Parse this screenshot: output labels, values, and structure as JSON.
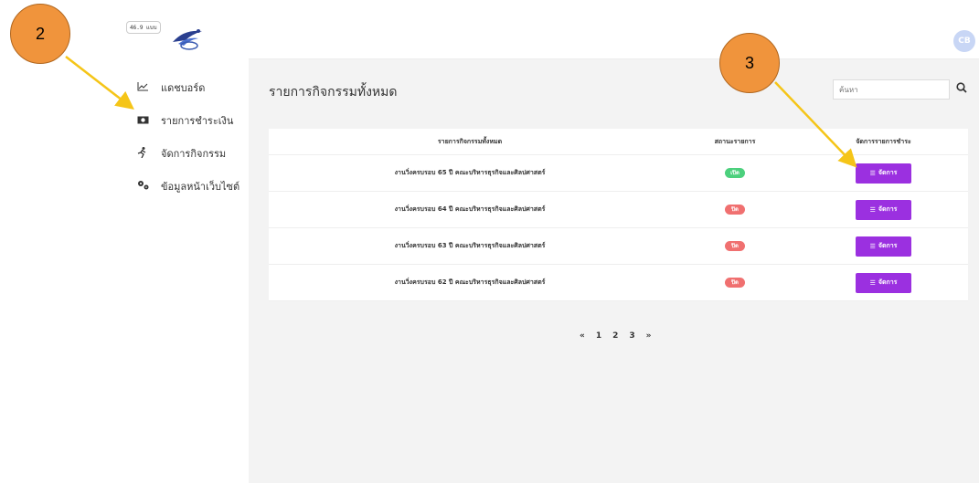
{
  "version_badge": "46.9 แบบ",
  "avatar_text": "CB",
  "sidebar": {
    "items": [
      {
        "label": "แดชบอร์ด",
        "icon": "chart-line-icon"
      },
      {
        "label": "รายการชำระเงิน",
        "icon": "money-bill-icon"
      },
      {
        "label": "จัดการกิจกรรม",
        "icon": "running-icon"
      },
      {
        "label": "ข้อมูลหน้าเว็บไซต์",
        "icon": "cogs-icon"
      }
    ]
  },
  "main": {
    "title": "รายการกิจกรรมทั้งหมด",
    "search_placeholder": "ค้นหา",
    "table": {
      "headers": [
        "รายการกิจกรรมทั้งหมด",
        "สถานะรายการ",
        "จัดการรายการชำระ"
      ],
      "rows": [
        {
          "name": "งานวิ่งครบรอบ 65 ปี คณะบริหารธุรกิจและศิลปศาสตร์",
          "status": "เปิด",
          "status_type": "open",
          "action": "จัดการ"
        },
        {
          "name": "งานวิ่งครบรอบ 64 ปี คณะบริหารธุรกิจและศิลปศาสตร์",
          "status": "ปิด",
          "status_type": "closed",
          "action": "จัดการ"
        },
        {
          "name": "งานวิ่งครบรอบ 63 ปี คณะบริหารธุรกิจและศิลปศาสตร์",
          "status": "ปิด",
          "status_type": "closed",
          "action": "จัดการ"
        },
        {
          "name": "งานวิ่งครบรอบ 62 ปี คณะบริหารธุรกิจและศิลปศาสตร์",
          "status": "ปิด",
          "status_type": "closed",
          "action": "จัดการ"
        }
      ]
    },
    "pagination": [
      "«",
      "1",
      "2",
      "3",
      "»"
    ]
  },
  "callouts": [
    "2",
    "3"
  ],
  "colors": {
    "accent": "#9b30e0",
    "status_open": "#4cd07d",
    "status_closed": "#f07070",
    "callout": "#f0943c",
    "arrow": "#f5c518"
  }
}
